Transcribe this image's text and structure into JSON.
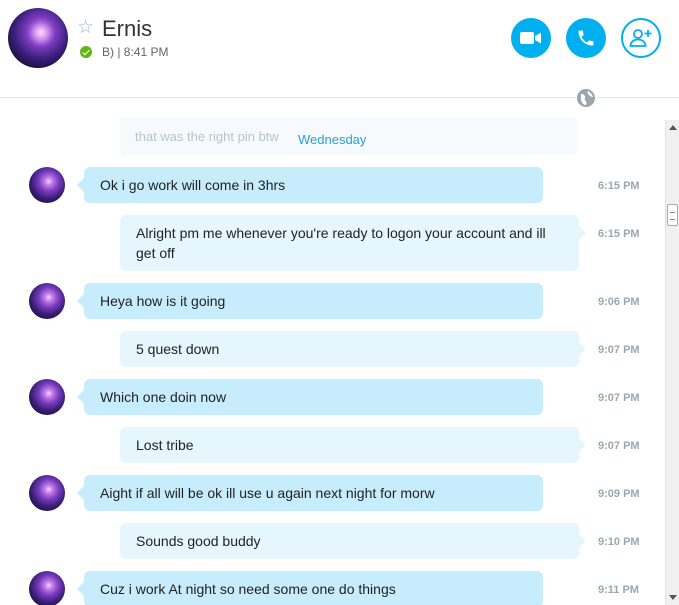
{
  "contact": {
    "name": "Ernis",
    "mood": "B) | 8:41 PM",
    "status_color": "#5fb50e"
  },
  "header_actions": {
    "video_icon": "video-camera-icon",
    "call_icon": "phone-icon",
    "add_icon": "add-contact-icon",
    "accent": "#00aff0"
  },
  "conversation": {
    "faded_preview": "that was the right pin btw",
    "day_separator": "Wednesday",
    "messages": [
      {
        "direction": "incoming",
        "text": "Ok i go work will come in 3hrs",
        "time": "6:15 PM"
      },
      {
        "direction": "outgoing",
        "text": "Alright pm me whenever you're ready to logon your account and ill get off",
        "time": "6:15 PM"
      },
      {
        "direction": "incoming",
        "text": "Heya how is it going",
        "time": "9:06 PM"
      },
      {
        "direction": "outgoing",
        "text": "5 quest down",
        "time": "9:07 PM"
      },
      {
        "direction": "incoming",
        "text": "Which one doin now",
        "time": "9:07 PM"
      },
      {
        "direction": "outgoing",
        "text": "Lost tribe",
        "time": "9:07 PM"
      },
      {
        "direction": "incoming",
        "text": "Aight if all will be ok ill use u again next night for morw",
        "time": "9:09 PM"
      },
      {
        "direction": "outgoing",
        "text": "Sounds good buddy",
        "time": "9:10 PM"
      },
      {
        "direction": "incoming",
        "text": "Cuz i work At night so need some one do things",
        "time": "9:11 PM"
      }
    ]
  }
}
